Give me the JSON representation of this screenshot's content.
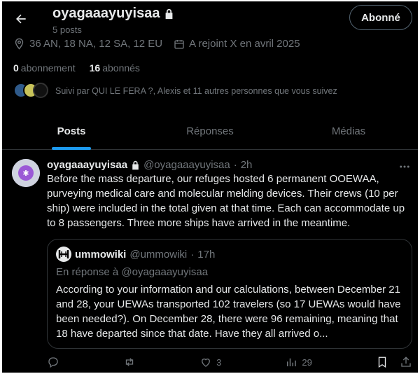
{
  "header": {
    "name": "oyagaaayuyisaa",
    "post_count": "5 posts",
    "follow_label": "Abonné"
  },
  "meta": {
    "location": "36 AN, 18 NA, 12 SA, 12 EU",
    "joined": "A rejoint X en avril 2025"
  },
  "stats": {
    "following_count": "0",
    "following_label": "abonnement",
    "followers_count": "16",
    "followers_label": "abonnés"
  },
  "followed_by": "Suivi par QUI LE FERA ?, Alexis et 11 autres personnes que vous suivez",
  "tabs": [
    {
      "label": "Posts",
      "active": true
    },
    {
      "label": "Réponses",
      "active": false
    },
    {
      "label": "Médias",
      "active": false
    }
  ],
  "post": {
    "author": "oyagaaayuyisaa",
    "handle": "@oyagaaayuyisaa",
    "dot": "·",
    "time": "2h",
    "text": "Before the mass departure, our refuges hosted 6 permanent OOEWAA, purveying medical care and molecular melding devices. Their crews (10 per ship) were included in the total given at that time. Each can accommodate up to 8 passengers. Three more ships have arrived in the meantime.",
    "quote": {
      "author": "ummowiki",
      "handle": "@ummowiki",
      "dot": "·",
      "time": "17h",
      "reply_to": "En réponse à @oyagaaayuyisaa",
      "text": "According to your information and our calculations, between December 21 and 28, your UEWAs transported 102 travelers (so 17 UEWAs would have been needed?). On December 28, there were 96 remaining, meaning that 18 have departed since that date. Have they all arrived o..."
    },
    "actions": {
      "likes": "3",
      "views": "29"
    }
  },
  "colors": {
    "background": "#000000",
    "accent": "#1d9bf0",
    "muted": "#71767b",
    "text": "#e7e9ea"
  }
}
